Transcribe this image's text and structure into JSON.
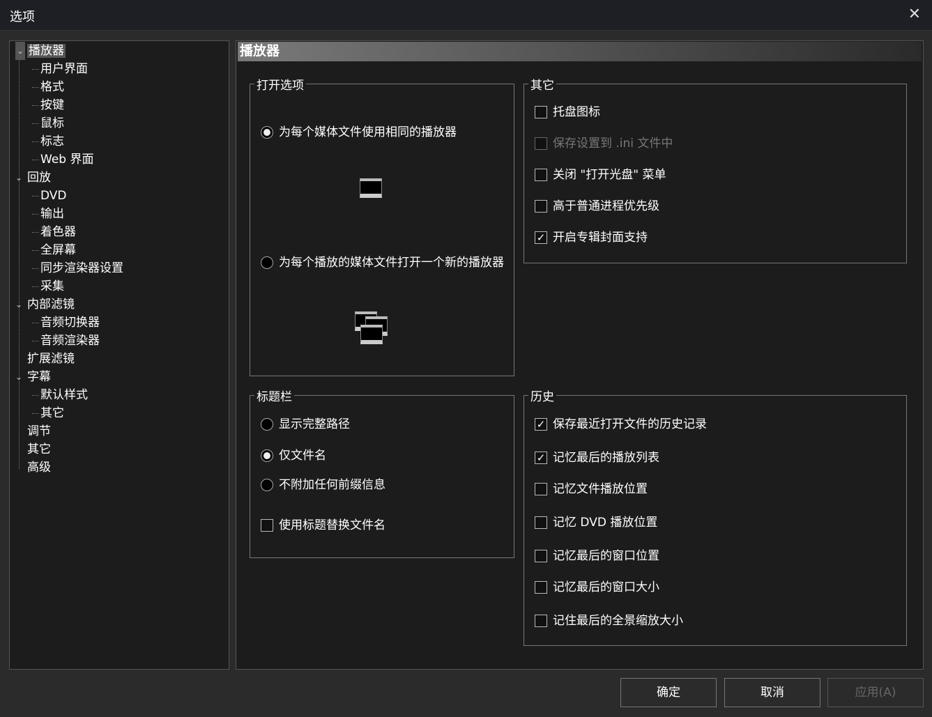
{
  "window": {
    "title": "选项",
    "close_icon": "close-icon"
  },
  "tree": [
    {
      "label": "播放器",
      "level": 0,
      "expanded": true,
      "selected": true
    },
    {
      "label": "用户界面",
      "level": 1
    },
    {
      "label": "格式",
      "level": 1
    },
    {
      "label": "按键",
      "level": 1
    },
    {
      "label": "鼠标",
      "level": 1
    },
    {
      "label": "标志",
      "level": 1
    },
    {
      "label": "Web 界面",
      "level": 1
    },
    {
      "label": "回放",
      "level": 0,
      "expanded": true
    },
    {
      "label": "DVD",
      "level": 1
    },
    {
      "label": "输出",
      "level": 1
    },
    {
      "label": "着色器",
      "level": 1
    },
    {
      "label": "全屏幕",
      "level": 1
    },
    {
      "label": "同步渲染器设置",
      "level": 1
    },
    {
      "label": "采集",
      "level": 1
    },
    {
      "label": "内部滤镜",
      "level": 0,
      "expanded": true
    },
    {
      "label": "音频切换器",
      "level": 1
    },
    {
      "label": "音频渲染器",
      "level": 1
    },
    {
      "label": "扩展滤镜",
      "level": 0
    },
    {
      "label": "字幕",
      "level": 0,
      "expanded": true
    },
    {
      "label": "默认样式",
      "level": 1
    },
    {
      "label": "其它",
      "level": 1
    },
    {
      "label": "调节",
      "level": 0
    },
    {
      "label": "其它",
      "level": 0
    },
    {
      "label": "高级",
      "level": 0
    }
  ],
  "page": {
    "header": "播放器",
    "open_options": {
      "title": "打开选项",
      "same_player": {
        "label": "为每个媒体文件使用相同的播放器",
        "checked": true
      },
      "new_player": {
        "label": "为每个播放的媒体文件打开一个新的播放器",
        "checked": false
      }
    },
    "other": {
      "title": "其它",
      "items": [
        {
          "label": "托盘图标",
          "checked": false
        },
        {
          "label": "保存设置到 .ini 文件中",
          "checked": false,
          "disabled": true
        },
        {
          "label": "关闭 \"打开光盘\" 菜单",
          "checked": false
        },
        {
          "label": "高于普通进程优先级",
          "checked": false
        },
        {
          "label": "开启专辑封面支持",
          "checked": true
        }
      ]
    },
    "titlebar": {
      "title": "标题栏",
      "radios": [
        {
          "label": "显示完整路径",
          "checked": false
        },
        {
          "label": "仅文件名",
          "checked": true
        },
        {
          "label": "不附加任何前缀信息",
          "checked": false
        }
      ],
      "use_title": {
        "label": "使用标题替换文件名",
        "checked": false
      }
    },
    "history": {
      "title": "历史",
      "items": [
        {
          "label": "保存最近打开文件的历史记录",
          "checked": true
        },
        {
          "label": "记忆最后的播放列表",
          "checked": true
        },
        {
          "label": "记忆文件播放位置",
          "checked": false
        },
        {
          "label": "记忆 DVD 播放位置",
          "checked": false
        },
        {
          "label": "记忆最后的窗口位置",
          "checked": false
        },
        {
          "label": "记忆最后的窗口大小",
          "checked": false
        },
        {
          "label": "记住最后的全景缩放大小",
          "checked": false
        }
      ]
    }
  },
  "buttons": {
    "ok": "确定",
    "cancel": "取消",
    "apply": "应用(A)"
  }
}
